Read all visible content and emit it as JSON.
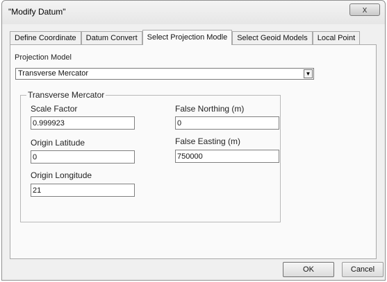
{
  "window": {
    "title": "\"Modify Datum\"",
    "close_glyph": "x",
    "close_icon": "close-icon"
  },
  "tabs": [
    {
      "label": "Define Coordinate",
      "selected": false
    },
    {
      "label": "Datum Convert",
      "selected": false
    },
    {
      "label": "Select Projection Modle",
      "selected": true
    },
    {
      "label": "Select Geoid Models",
      "selected": false
    },
    {
      "label": "Local Point",
      "selected": false
    }
  ],
  "projection": {
    "label": "Projection Model",
    "selected": "Transverse Mercator",
    "arrow_glyph": "▼",
    "arrow_icon": "chevron-down-icon"
  },
  "group": {
    "title": "Transverse Mercator",
    "scale_factor": {
      "label": "Scale Factor",
      "value": "0.999923"
    },
    "origin_latitude": {
      "label": "Origin Latitude",
      "value": "0"
    },
    "origin_longitude": {
      "label": "Origin Longitude",
      "value": "21"
    },
    "false_northing": {
      "label": "False Northing (m)",
      "value": "0"
    },
    "false_easting": {
      "label": "False Easting (m)",
      "value": "750000"
    }
  },
  "buttons": {
    "ok": "OK",
    "cancel": "Cancel"
  }
}
